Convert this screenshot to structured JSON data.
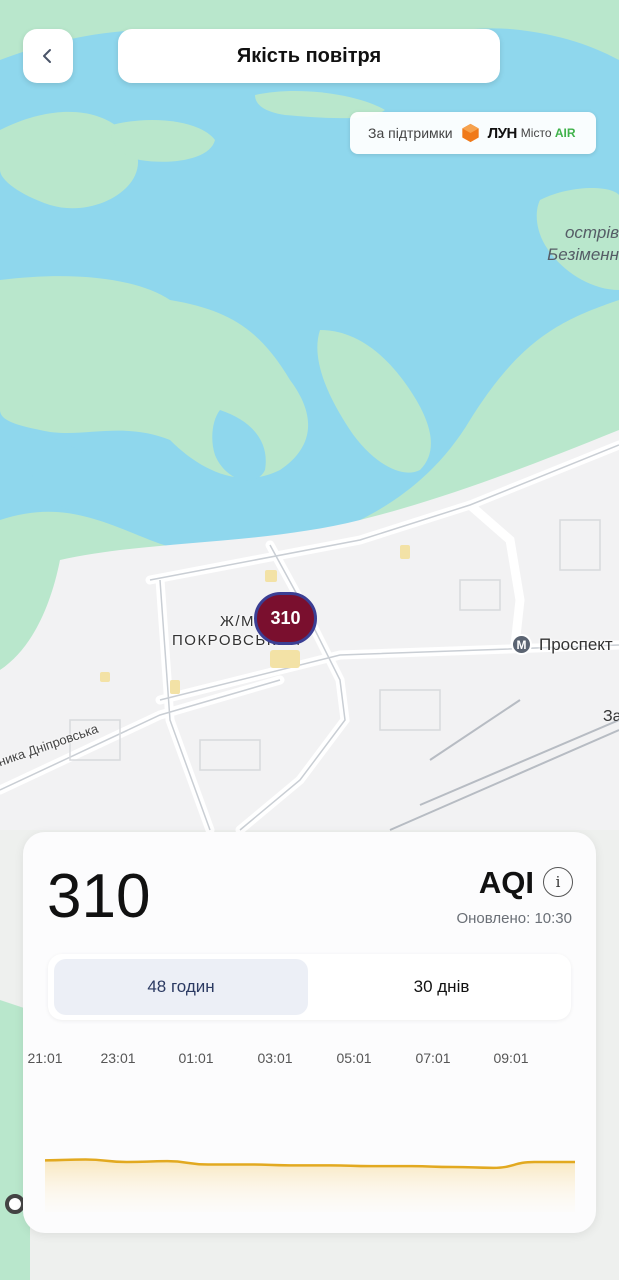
{
  "header": {
    "title": "Якість повітря",
    "back_icon": "chevron-left-icon"
  },
  "sponsor": {
    "prefix": "За підтримки",
    "brand": "ЛУН",
    "product": "Місто",
    "product_accent": "AIR",
    "brand_color": "#f07a1a",
    "accent_color": "#40b24b"
  },
  "map": {
    "island_label_line1": "острів",
    "island_label_line2": "Безіменн",
    "district_label_line1": "Ж/М",
    "district_label_line2": "ПОКРОВСЬКИЙ",
    "street_label": "ника Дніпровська",
    "metro_icon_text": "М",
    "metro_label": "Проспект",
    "edge_label": "За",
    "marker_value": "310",
    "marker_color": "#7a0f2e"
  },
  "card": {
    "aqi_value": "310",
    "aqi_label": "AQI",
    "info_icon": "info-icon",
    "updated": "Оновлено: 10:30",
    "tabs": [
      {
        "label": "48 годин",
        "active": true
      },
      {
        "label": "30 днів",
        "active": false
      }
    ],
    "time_ticks": [
      "21:01",
      "23:01",
      "01:01",
      "03:01",
      "05:01",
      "07:01",
      "09:01"
    ]
  },
  "chart_data": {
    "type": "area",
    "x": [
      "21:01",
      "22:01",
      "23:01",
      "00:01",
      "01:01",
      "02:01",
      "03:01",
      "04:01",
      "05:01",
      "06:01",
      "07:01",
      "08:01",
      "09:01",
      "10:01"
    ],
    "series": [
      {
        "values": [
          150,
          151,
          148,
          149,
          145,
          145,
          144,
          144,
          143,
          143,
          142,
          141,
          148,
          148
        ]
      }
    ],
    "ylim": [
      100,
      160
    ],
    "line_color": "#e2a920",
    "grid": false
  }
}
